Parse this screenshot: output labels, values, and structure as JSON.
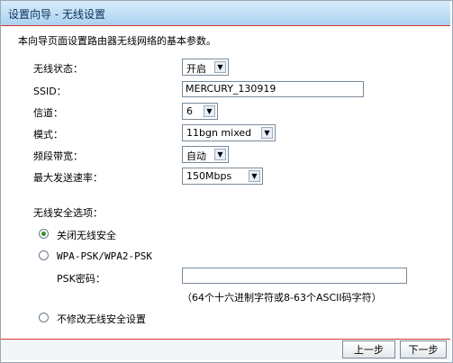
{
  "title": "设置向导 - 无线设置",
  "intro": "本向导页面设置路由器无线网络的基本参数。",
  "fields": {
    "wireless_state": {
      "label": "无线状态：",
      "value": "开启"
    },
    "ssid": {
      "label": "SSID：",
      "value": "MERCURY_130919"
    },
    "channel": {
      "label": "信道：",
      "value": "6"
    },
    "mode": {
      "label": "模式：",
      "value": "11bgn mixed"
    },
    "bandwidth": {
      "label": "频段带宽：",
      "value": "自动"
    },
    "max_rate": {
      "label": "最大发送速率：",
      "value": "150Mbps"
    }
  },
  "security": {
    "heading": "无线安全选项：",
    "option_off": "关闭无线安全",
    "option_wpa": "WPA-PSK/WPA2-PSK",
    "psk_label": "PSK密码：",
    "psk_value": "",
    "psk_hint": "（64个十六进制字符或8-63个ASCII码字符）",
    "option_keep": "不修改无线安全设置",
    "selected": "option_off"
  },
  "buttons": {
    "prev": "上一步",
    "next": "下一步"
  },
  "colors": {
    "title_bg": "#a9d3f2",
    "divider": "#dd3333",
    "radio_on": "#3c8e2f"
  }
}
